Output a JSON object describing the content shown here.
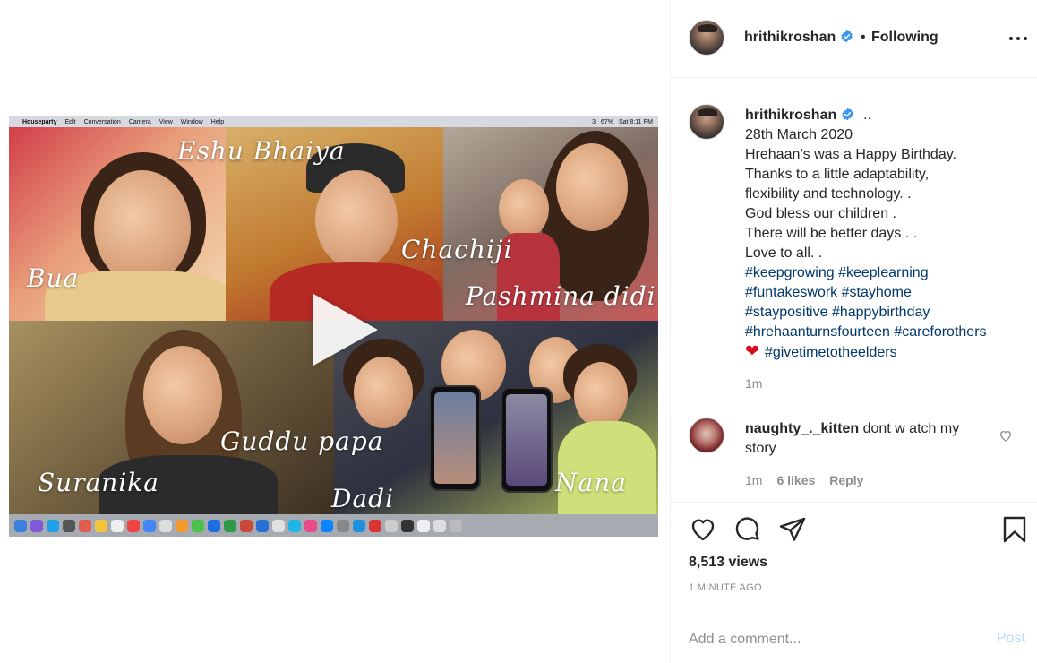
{
  "post": {
    "author": "hrithikroshan",
    "bullet": "•",
    "follow_status": "Following",
    "more_icon": "more-horizontal-icon",
    "verified_icon": "verified-badge-icon"
  },
  "video": {
    "menubar": {
      "apple": "",
      "app": "Houseparty",
      "items": [
        "Edit",
        "Conversation",
        "Camera",
        "View",
        "Window",
        "Help"
      ],
      "status": [
        "3",
        "67%",
        "Sat 8:11 PM"
      ]
    },
    "labels": {
      "eshu": "Eshu Bhaiya",
      "bua": "Bua",
      "chachiji": "Chachiji",
      "pashmina": "Pashmina didi",
      "suranika": "Suranika",
      "guddu": "Guddu papa",
      "dadi": "Dadi",
      "nana": "Nana"
    },
    "play_icon": "play-icon"
  },
  "caption": {
    "username": "hrithikroshan",
    "dots": "..",
    "lines": [
      "28th March 2020",
      "Hrehaan’s was a Happy Birthday.",
      "Thanks to a little adaptability,",
      "flexibility and technology. .",
      "God bless our children .",
      "There will be better days . .",
      "Love to all. ."
    ],
    "hashtags": [
      [
        "#keepgrowing",
        "#keeplearning"
      ],
      [
        "#funtakeswork",
        "#stayhome"
      ],
      [
        "#staypositive",
        "#happybirthday"
      ],
      [
        "#hrehaanturnsfourteen",
        "#careforothers"
      ]
    ],
    "heart_emoji": "❤",
    "last_hashtag": "#givetimetotheelders",
    "time": "1m"
  },
  "comment": {
    "username": "naughty_._kitten",
    "text": "dont w atch my story",
    "time": "1m",
    "likes": "6 likes",
    "reply": "Reply",
    "like_icon": "heart-outline-small-icon"
  },
  "actions": {
    "like_icon": "heart-outline-icon",
    "comment_icon": "comment-bubble-icon",
    "share_icon": "paper-plane-icon",
    "save_icon": "bookmark-icon"
  },
  "stats": {
    "views": "8,513 views",
    "ago": "1 MINUTE AGO"
  },
  "add_comment": {
    "placeholder": "Add a comment...",
    "post_label": "Post"
  },
  "colors": {
    "text": "#262626",
    "muted": "#8e8e8e",
    "hashtag": "#00376b",
    "verified": "#3897f0",
    "post_disabled": "#b3dbff",
    "emoji_heart": "#d9091c"
  }
}
